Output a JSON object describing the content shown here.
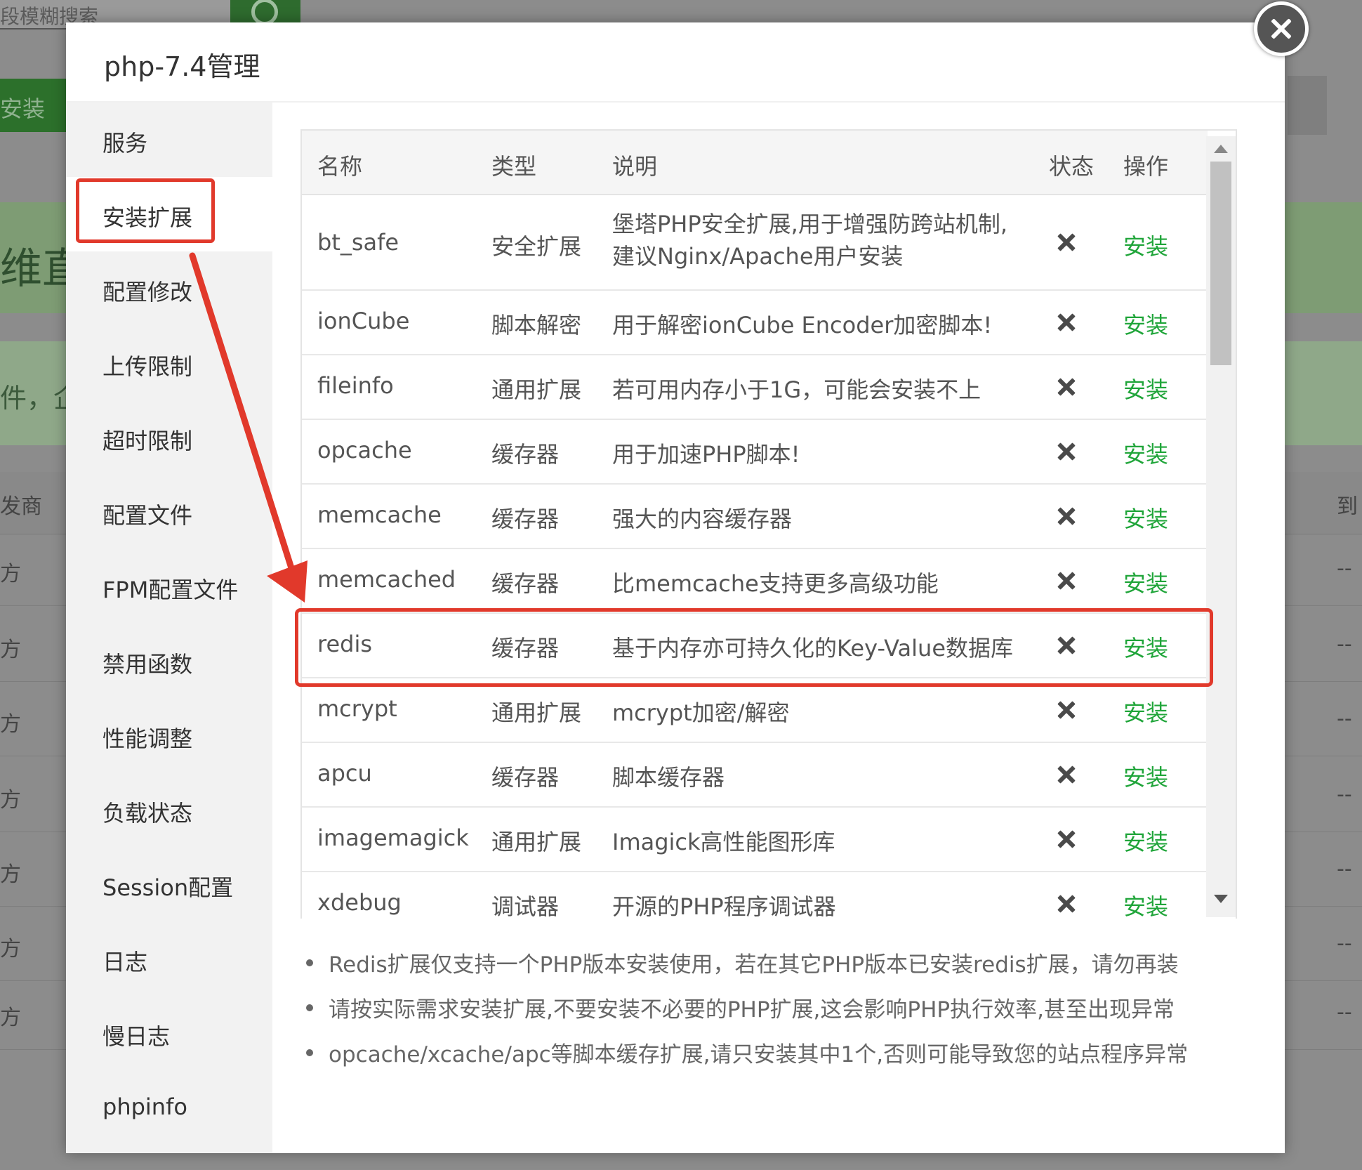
{
  "background": {
    "search_placeholder": "段模糊搜索",
    "install_button": "安装",
    "banner_text": "维直",
    "banner_text2": "件，企",
    "table_header_left": "发商",
    "table_header_right": "到",
    "row_left": "方",
    "row_right": "--"
  },
  "modal": {
    "title": "php-7.4管理",
    "sidebar": [
      {
        "label": "服务"
      },
      {
        "label": "安装扩展"
      },
      {
        "label": "配置修改"
      },
      {
        "label": "上传限制"
      },
      {
        "label": "超时限制"
      },
      {
        "label": "配置文件"
      },
      {
        "label": "FPM配置文件"
      },
      {
        "label": "禁用函数"
      },
      {
        "label": "性能调整"
      },
      {
        "label": "负载状态"
      },
      {
        "label": "Session配置"
      },
      {
        "label": "日志"
      },
      {
        "label": "慢日志"
      },
      {
        "label": "phpinfo"
      }
    ],
    "active_sidebar": "安装扩展",
    "table": {
      "headers": {
        "name": "名称",
        "type": "类型",
        "desc": "说明",
        "status": "状态",
        "action": "操作"
      },
      "rows": [
        {
          "name": "bt_safe",
          "type": "安全扩展",
          "desc_line1": "堡塔PHP安全扩展,用于增强防跨站机制,",
          "desc_line2": "建议Nginx/Apache用户安装",
          "status": "not-installed",
          "action": "安装"
        },
        {
          "name": "ionCube",
          "type": "脚本解密",
          "desc_line1": "用于解密ionCube Encoder加密脚本!",
          "status": "not-installed",
          "action": "安装"
        },
        {
          "name": "fileinfo",
          "type": "通用扩展",
          "desc_line1": "若可用内存小于1G，可能会安装不上",
          "status": "not-installed",
          "action": "安装"
        },
        {
          "name": "opcache",
          "type": "缓存器",
          "desc_line1": "用于加速PHP脚本!",
          "status": "not-installed",
          "action": "安装"
        },
        {
          "name": "memcache",
          "type": "缓存器",
          "desc_line1": "强大的内容缓存器",
          "status": "not-installed",
          "action": "安装"
        },
        {
          "name": "memcached",
          "type": "缓存器",
          "desc_line1": "比memcache支持更多高级功能",
          "status": "not-installed",
          "action": "安装"
        },
        {
          "name": "redis",
          "type": "缓存器",
          "desc_line1": "基于内存亦可持久化的Key-Value数据库",
          "status": "not-installed",
          "action": "安装"
        },
        {
          "name": "mcrypt",
          "type": "通用扩展",
          "desc_line1": "mcrypt加密/解密",
          "status": "not-installed",
          "action": "安装"
        },
        {
          "name": "apcu",
          "type": "缓存器",
          "desc_line1": "脚本缓存器",
          "status": "not-installed",
          "action": "安装"
        },
        {
          "name": "imagemagick",
          "type": "通用扩展",
          "desc_line1": "Imagick高性能图形库",
          "status": "not-installed",
          "action": "安装"
        },
        {
          "name": "xdebug",
          "type": "调试器",
          "desc_line1": "开源的PHP程序调试器",
          "status": "not-installed",
          "action": "安装"
        }
      ]
    },
    "notes": [
      "Redis扩展仅支持一个PHP版本安装使用，若在其它PHP版本已安装redis扩展，请勿再装",
      "请按实际需求安装扩展,不要安装不必要的PHP扩展,这会影响PHP执行效率,甚至出现异常",
      "opcache/xcache/apc等脚本缓存扩展,请只安装其中1个,否则可能导致您的站点程序异常"
    ]
  },
  "colors": {
    "accent_green": "#20a53a",
    "annotation_red": "#e1392b"
  },
  "icons": {
    "close": "close-icon",
    "status": "x-icon",
    "scroll_up": "chevron-up-icon",
    "scroll_down": "chevron-down-icon"
  }
}
